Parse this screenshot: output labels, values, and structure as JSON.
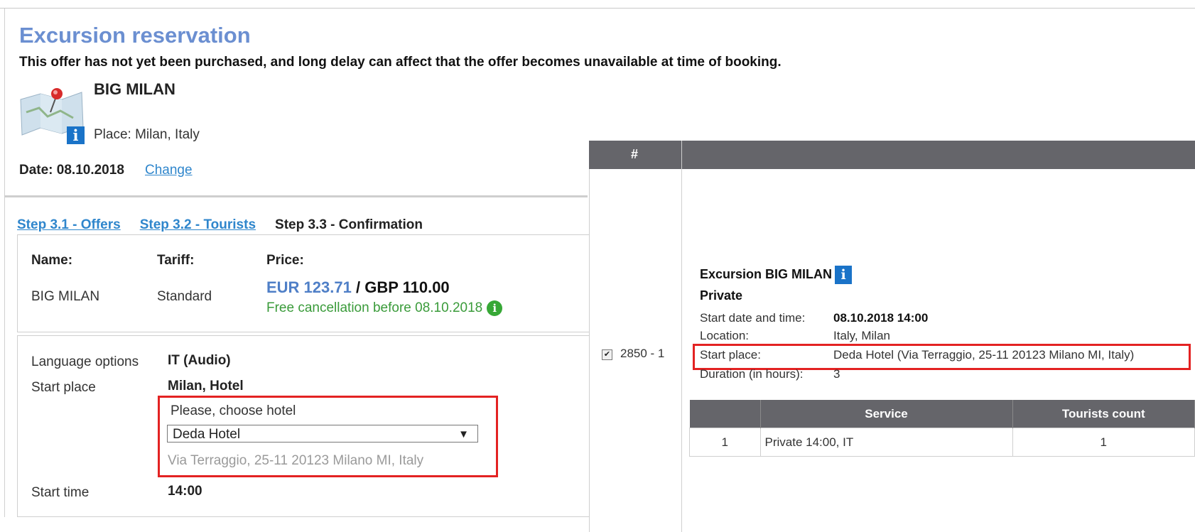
{
  "page_title": "Excursion reservation",
  "warning": "This offer has not yet been purchased, and long delay can affect that the offer becomes unavailable at time of booking.",
  "offer": {
    "name": "BIG MILAN",
    "place": "Place: Milan, Italy",
    "info_icon": "i"
  },
  "date": {
    "label": "Date: 08.10.2018",
    "change_link": "Change"
  },
  "steps": {
    "step1": "Step 3.1 - Offers",
    "step2": "Step 3.2 - Tourists",
    "step3": "Step 3.3 - Confirmation"
  },
  "summary": {
    "name_label": "Name:",
    "tariff_label": "Tariff:",
    "price_label": "Price:",
    "name_value": "BIG MILAN",
    "tariff_value": "Standard",
    "price_eur": "EUR 123.71",
    "price_sep": " / ",
    "price_gbp": "GBP 110.00",
    "free_cancel": "Free cancellation before 08.10.2018",
    "cancel_info_icon": "i"
  },
  "options": {
    "language_label": "Language options",
    "language_value": "IT (Audio)",
    "start_place_label": "Start place",
    "start_place_value": "Milan, Hotel",
    "choose_hotel": "Please, choose hotel",
    "hotel_selected": "Deda Hotel",
    "dropdown_arrow": "▼",
    "hotel_address": "Via Terraggio, 25-11 20123 Milano MI, Italy",
    "start_time_label": "Start time",
    "start_time_value": "14:00"
  },
  "panel": {
    "header_hash": "#",
    "row_id": "2850 - 1",
    "checkbox_mark": "✔",
    "excursion_label": "Excursion",
    "excursion_name": "BIG MILAN",
    "excursion_info_icon": "i",
    "type": "Private",
    "start_dt_label": "Start date and time:",
    "start_dt_value": "08.10.2018  14:00",
    "location_label": "Location:",
    "location_value": "Italy, Milan",
    "start_place_label": "Start place:",
    "start_place_value": "Deda Hotel (Via Terraggio, 25-11 20123 Milano MI, Italy)",
    "duration_label": "Duration (in hours):",
    "duration_value": "3",
    "table": {
      "headers": [
        "",
        "Service",
        "Tourists count"
      ],
      "rows": [
        [
          "1",
          "Private 14:00, IT",
          "1"
        ]
      ]
    }
  },
  "colors": {
    "title": "#6b8fd1",
    "link": "#2f86cc",
    "green": "#3a9b3a",
    "highlight": "#e32222",
    "header_bg": "#65656a"
  }
}
